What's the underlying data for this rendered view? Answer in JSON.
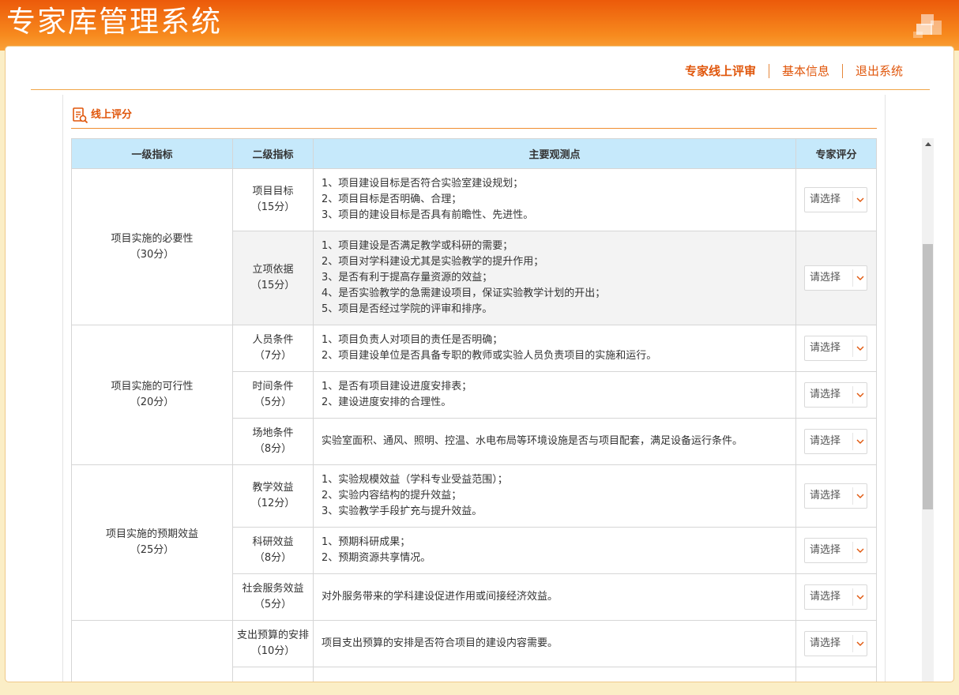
{
  "app": {
    "title": "专家库管理系统"
  },
  "topnav": {
    "items": [
      {
        "label": "专家线上评审",
        "active": true
      },
      {
        "label": "基本信息",
        "active": false
      },
      {
        "label": "退出系统",
        "active": false
      }
    ]
  },
  "section": {
    "title": "线上评分",
    "icon": "score-document-icon"
  },
  "table": {
    "headers": [
      "一级指标",
      "二级指标",
      "主要观测点",
      "专家评分"
    ],
    "select_placeholder": "请选择",
    "groups": [
      {
        "name": "项目实施的必要性",
        "score": "（30分）",
        "rows": [
          {
            "name": "项目目标",
            "score": "（15分）",
            "points": [
              "1、项目建设目标是否符合实验室建设规划；",
              "2、项目目标是否明确、合理；",
              "3、项目的建设目标是否具有前瞻性、先进性。"
            ]
          },
          {
            "name": "立项依据",
            "score": "（15分）",
            "points": [
              "1、项目建设是否满足教学或科研的需要；",
              "2、项目对学科建设尤其是实验教学的提升作用；",
              "3、是否有利于提高存量资源的效益；",
              "4、是否实验教学的急需建设项目，保证实验教学计划的开出；",
              "5、项目是否经过学院的评审和排序。"
            ]
          }
        ]
      },
      {
        "name": "项目实施的可行性",
        "score": "（20分）",
        "rows": [
          {
            "name": "人员条件",
            "score": "（7分）",
            "points": [
              "1、项目负责人对项目的责任是否明确；",
              "2、项目建设单位是否具备专职的教师或实验人员负责项目的实施和运行。"
            ]
          },
          {
            "name": "时间条件",
            "score": "（5分）",
            "points": [
              "1、是否有项目建设进度安排表；",
              "2、建设进度安排的合理性。"
            ]
          },
          {
            "name": "场地条件",
            "score": "（8分）",
            "points": [
              "实验室面积、通风、照明、控温、水电布局等环境设施是否与项目配套，满足设备运行条件。"
            ]
          }
        ]
      },
      {
        "name": "项目实施的预期效益",
        "score": "（25分）",
        "rows": [
          {
            "name": "教学效益",
            "score": "（12分）",
            "points": [
              "1、实验规模效益（学科专业受益范围）；",
              "2、实验内容结构的提升效益；",
              "3、实验教学手段扩充与提升效益。"
            ]
          },
          {
            "name": "科研效益",
            "score": "（8分）",
            "points": [
              "1、预期科研成果；",
              "2、预期资源共享情况。"
            ]
          },
          {
            "name": "社会服务效益",
            "score": "（5分）",
            "points": [
              "对外服务带来的学科建设促进作用或间接经济效益。"
            ]
          }
        ]
      },
      {
        "name": "",
        "score": "",
        "rows": [
          {
            "name": "支出预算的安排",
            "score": "（10分）",
            "points": [
              "项目支出预算的安排是否符合项目的建设内容需要。"
            ]
          },
          {
            "name": "",
            "score": "",
            "points": []
          }
        ]
      }
    ]
  },
  "colors": {
    "header_orange": "#ec5a0a",
    "accent": "#e0560b",
    "table_header_bg": "#c6e9fb",
    "page_bg": "#fbeec6"
  }
}
